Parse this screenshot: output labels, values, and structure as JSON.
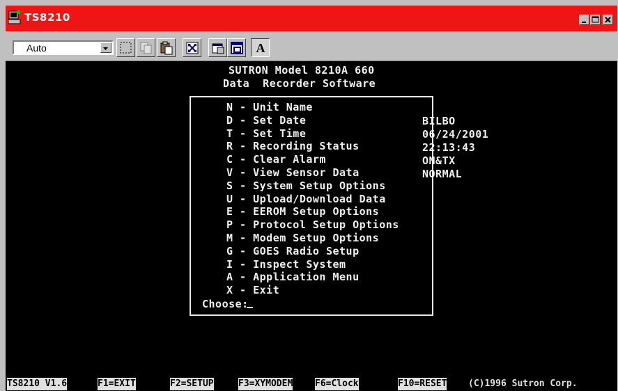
{
  "window": {
    "title": "TS8210",
    "title_color": "#f01414",
    "icon": "terminal-app-icon"
  },
  "toolbar": {
    "font_select_value": "Auto",
    "buttons": [
      {
        "icon": "select-icon"
      },
      {
        "icon": "copy-icon"
      },
      {
        "icon": "paste-icon"
      },
      {
        "icon": "fullscreen-icon"
      },
      {
        "icon": "properties-icon"
      },
      {
        "icon": "background-icon"
      },
      {
        "icon": "font-icon",
        "label": "A"
      }
    ]
  },
  "terminal": {
    "header_line1": "SUTRON Model 8210A 660",
    "header_line2": "Data  Recorder Software",
    "menu": [
      {
        "key": "N",
        "label": "Unit Name"
      },
      {
        "key": "D",
        "label": "Set Date"
      },
      {
        "key": "T",
        "label": "Set Time"
      },
      {
        "key": "R",
        "label": "Recording Status"
      },
      {
        "key": "C",
        "label": "Clear Alarm"
      },
      {
        "key": "V",
        "label": "View Sensor Data"
      },
      {
        "key": "S",
        "label": "System Setup Options"
      },
      {
        "key": "U",
        "label": "Upload/Download Data"
      },
      {
        "key": "E",
        "label": "EEROM Setup Options"
      },
      {
        "key": "P",
        "label": "Protocol Setup Options"
      },
      {
        "key": "M",
        "label": "Modem Setup Options"
      },
      {
        "key": "G",
        "label": "GOES Radio Setup"
      },
      {
        "key": "I",
        "label": "Inspect System"
      },
      {
        "key": "A",
        "label": "Application Menu"
      },
      {
        "key": "X",
        "label": "Exit"
      }
    ],
    "prompt": "Choose:",
    "values": {
      "unit_name": "BILBO",
      "date": "06/24/2001",
      "time": "22:13:43",
      "recording_status": "ON&TX",
      "alarm": "NORMAL"
    }
  },
  "statusbar": {
    "version": "TS8210 V1.6",
    "f1": "F1=EXIT",
    "f2": "F2=SETUP",
    "f3": "F3=XYMODEM",
    "f6": "F6=Clock",
    "f10": "F10=RESET",
    "copyright": "(C)1996 Sutron Corp."
  }
}
